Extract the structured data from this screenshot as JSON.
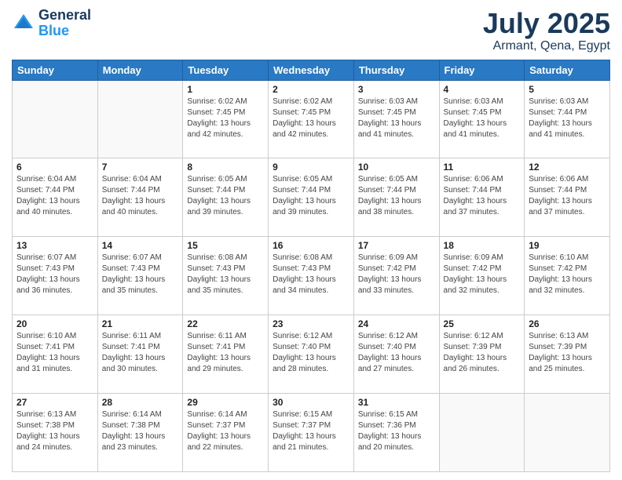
{
  "header": {
    "logo_line1": "General",
    "logo_line2": "Blue",
    "month": "July 2025",
    "location": "Armant, Qena, Egypt"
  },
  "days_of_week": [
    "Sunday",
    "Monday",
    "Tuesday",
    "Wednesday",
    "Thursday",
    "Friday",
    "Saturday"
  ],
  "weeks": [
    [
      {
        "day": "",
        "sunrise": "",
        "sunset": "",
        "daylight": ""
      },
      {
        "day": "",
        "sunrise": "",
        "sunset": "",
        "daylight": ""
      },
      {
        "day": "1",
        "sunrise": "Sunrise: 6:02 AM",
        "sunset": "Sunset: 7:45 PM",
        "daylight": "Daylight: 13 hours and 42 minutes."
      },
      {
        "day": "2",
        "sunrise": "Sunrise: 6:02 AM",
        "sunset": "Sunset: 7:45 PM",
        "daylight": "Daylight: 13 hours and 42 minutes."
      },
      {
        "day": "3",
        "sunrise": "Sunrise: 6:03 AM",
        "sunset": "Sunset: 7:45 PM",
        "daylight": "Daylight: 13 hours and 41 minutes."
      },
      {
        "day": "4",
        "sunrise": "Sunrise: 6:03 AM",
        "sunset": "Sunset: 7:45 PM",
        "daylight": "Daylight: 13 hours and 41 minutes."
      },
      {
        "day": "5",
        "sunrise": "Sunrise: 6:03 AM",
        "sunset": "Sunset: 7:44 PM",
        "daylight": "Daylight: 13 hours and 41 minutes."
      }
    ],
    [
      {
        "day": "6",
        "sunrise": "Sunrise: 6:04 AM",
        "sunset": "Sunset: 7:44 PM",
        "daylight": "Daylight: 13 hours and 40 minutes."
      },
      {
        "day": "7",
        "sunrise": "Sunrise: 6:04 AM",
        "sunset": "Sunset: 7:44 PM",
        "daylight": "Daylight: 13 hours and 40 minutes."
      },
      {
        "day": "8",
        "sunrise": "Sunrise: 6:05 AM",
        "sunset": "Sunset: 7:44 PM",
        "daylight": "Daylight: 13 hours and 39 minutes."
      },
      {
        "day": "9",
        "sunrise": "Sunrise: 6:05 AM",
        "sunset": "Sunset: 7:44 PM",
        "daylight": "Daylight: 13 hours and 39 minutes."
      },
      {
        "day": "10",
        "sunrise": "Sunrise: 6:05 AM",
        "sunset": "Sunset: 7:44 PM",
        "daylight": "Daylight: 13 hours and 38 minutes."
      },
      {
        "day": "11",
        "sunrise": "Sunrise: 6:06 AM",
        "sunset": "Sunset: 7:44 PM",
        "daylight": "Daylight: 13 hours and 37 minutes."
      },
      {
        "day": "12",
        "sunrise": "Sunrise: 6:06 AM",
        "sunset": "Sunset: 7:44 PM",
        "daylight": "Daylight: 13 hours and 37 minutes."
      }
    ],
    [
      {
        "day": "13",
        "sunrise": "Sunrise: 6:07 AM",
        "sunset": "Sunset: 7:43 PM",
        "daylight": "Daylight: 13 hours and 36 minutes."
      },
      {
        "day": "14",
        "sunrise": "Sunrise: 6:07 AM",
        "sunset": "Sunset: 7:43 PM",
        "daylight": "Daylight: 13 hours and 35 minutes."
      },
      {
        "day": "15",
        "sunrise": "Sunrise: 6:08 AM",
        "sunset": "Sunset: 7:43 PM",
        "daylight": "Daylight: 13 hours and 35 minutes."
      },
      {
        "day": "16",
        "sunrise": "Sunrise: 6:08 AM",
        "sunset": "Sunset: 7:43 PM",
        "daylight": "Daylight: 13 hours and 34 minutes."
      },
      {
        "day": "17",
        "sunrise": "Sunrise: 6:09 AM",
        "sunset": "Sunset: 7:42 PM",
        "daylight": "Daylight: 13 hours and 33 minutes."
      },
      {
        "day": "18",
        "sunrise": "Sunrise: 6:09 AM",
        "sunset": "Sunset: 7:42 PM",
        "daylight": "Daylight: 13 hours and 32 minutes."
      },
      {
        "day": "19",
        "sunrise": "Sunrise: 6:10 AM",
        "sunset": "Sunset: 7:42 PM",
        "daylight": "Daylight: 13 hours and 32 minutes."
      }
    ],
    [
      {
        "day": "20",
        "sunrise": "Sunrise: 6:10 AM",
        "sunset": "Sunset: 7:41 PM",
        "daylight": "Daylight: 13 hours and 31 minutes."
      },
      {
        "day": "21",
        "sunrise": "Sunrise: 6:11 AM",
        "sunset": "Sunset: 7:41 PM",
        "daylight": "Daylight: 13 hours and 30 minutes."
      },
      {
        "day": "22",
        "sunrise": "Sunrise: 6:11 AM",
        "sunset": "Sunset: 7:41 PM",
        "daylight": "Daylight: 13 hours and 29 minutes."
      },
      {
        "day": "23",
        "sunrise": "Sunrise: 6:12 AM",
        "sunset": "Sunset: 7:40 PM",
        "daylight": "Daylight: 13 hours and 28 minutes."
      },
      {
        "day": "24",
        "sunrise": "Sunrise: 6:12 AM",
        "sunset": "Sunset: 7:40 PM",
        "daylight": "Daylight: 13 hours and 27 minutes."
      },
      {
        "day": "25",
        "sunrise": "Sunrise: 6:12 AM",
        "sunset": "Sunset: 7:39 PM",
        "daylight": "Daylight: 13 hours and 26 minutes."
      },
      {
        "day": "26",
        "sunrise": "Sunrise: 6:13 AM",
        "sunset": "Sunset: 7:39 PM",
        "daylight": "Daylight: 13 hours and 25 minutes."
      }
    ],
    [
      {
        "day": "27",
        "sunrise": "Sunrise: 6:13 AM",
        "sunset": "Sunset: 7:38 PM",
        "daylight": "Daylight: 13 hours and 24 minutes."
      },
      {
        "day": "28",
        "sunrise": "Sunrise: 6:14 AM",
        "sunset": "Sunset: 7:38 PM",
        "daylight": "Daylight: 13 hours and 23 minutes."
      },
      {
        "day": "29",
        "sunrise": "Sunrise: 6:14 AM",
        "sunset": "Sunset: 7:37 PM",
        "daylight": "Daylight: 13 hours and 22 minutes."
      },
      {
        "day": "30",
        "sunrise": "Sunrise: 6:15 AM",
        "sunset": "Sunset: 7:37 PM",
        "daylight": "Daylight: 13 hours and 21 minutes."
      },
      {
        "day": "31",
        "sunrise": "Sunrise: 6:15 AM",
        "sunset": "Sunset: 7:36 PM",
        "daylight": "Daylight: 13 hours and 20 minutes."
      },
      {
        "day": "",
        "sunrise": "",
        "sunset": "",
        "daylight": ""
      },
      {
        "day": "",
        "sunrise": "",
        "sunset": "",
        "daylight": ""
      }
    ]
  ]
}
